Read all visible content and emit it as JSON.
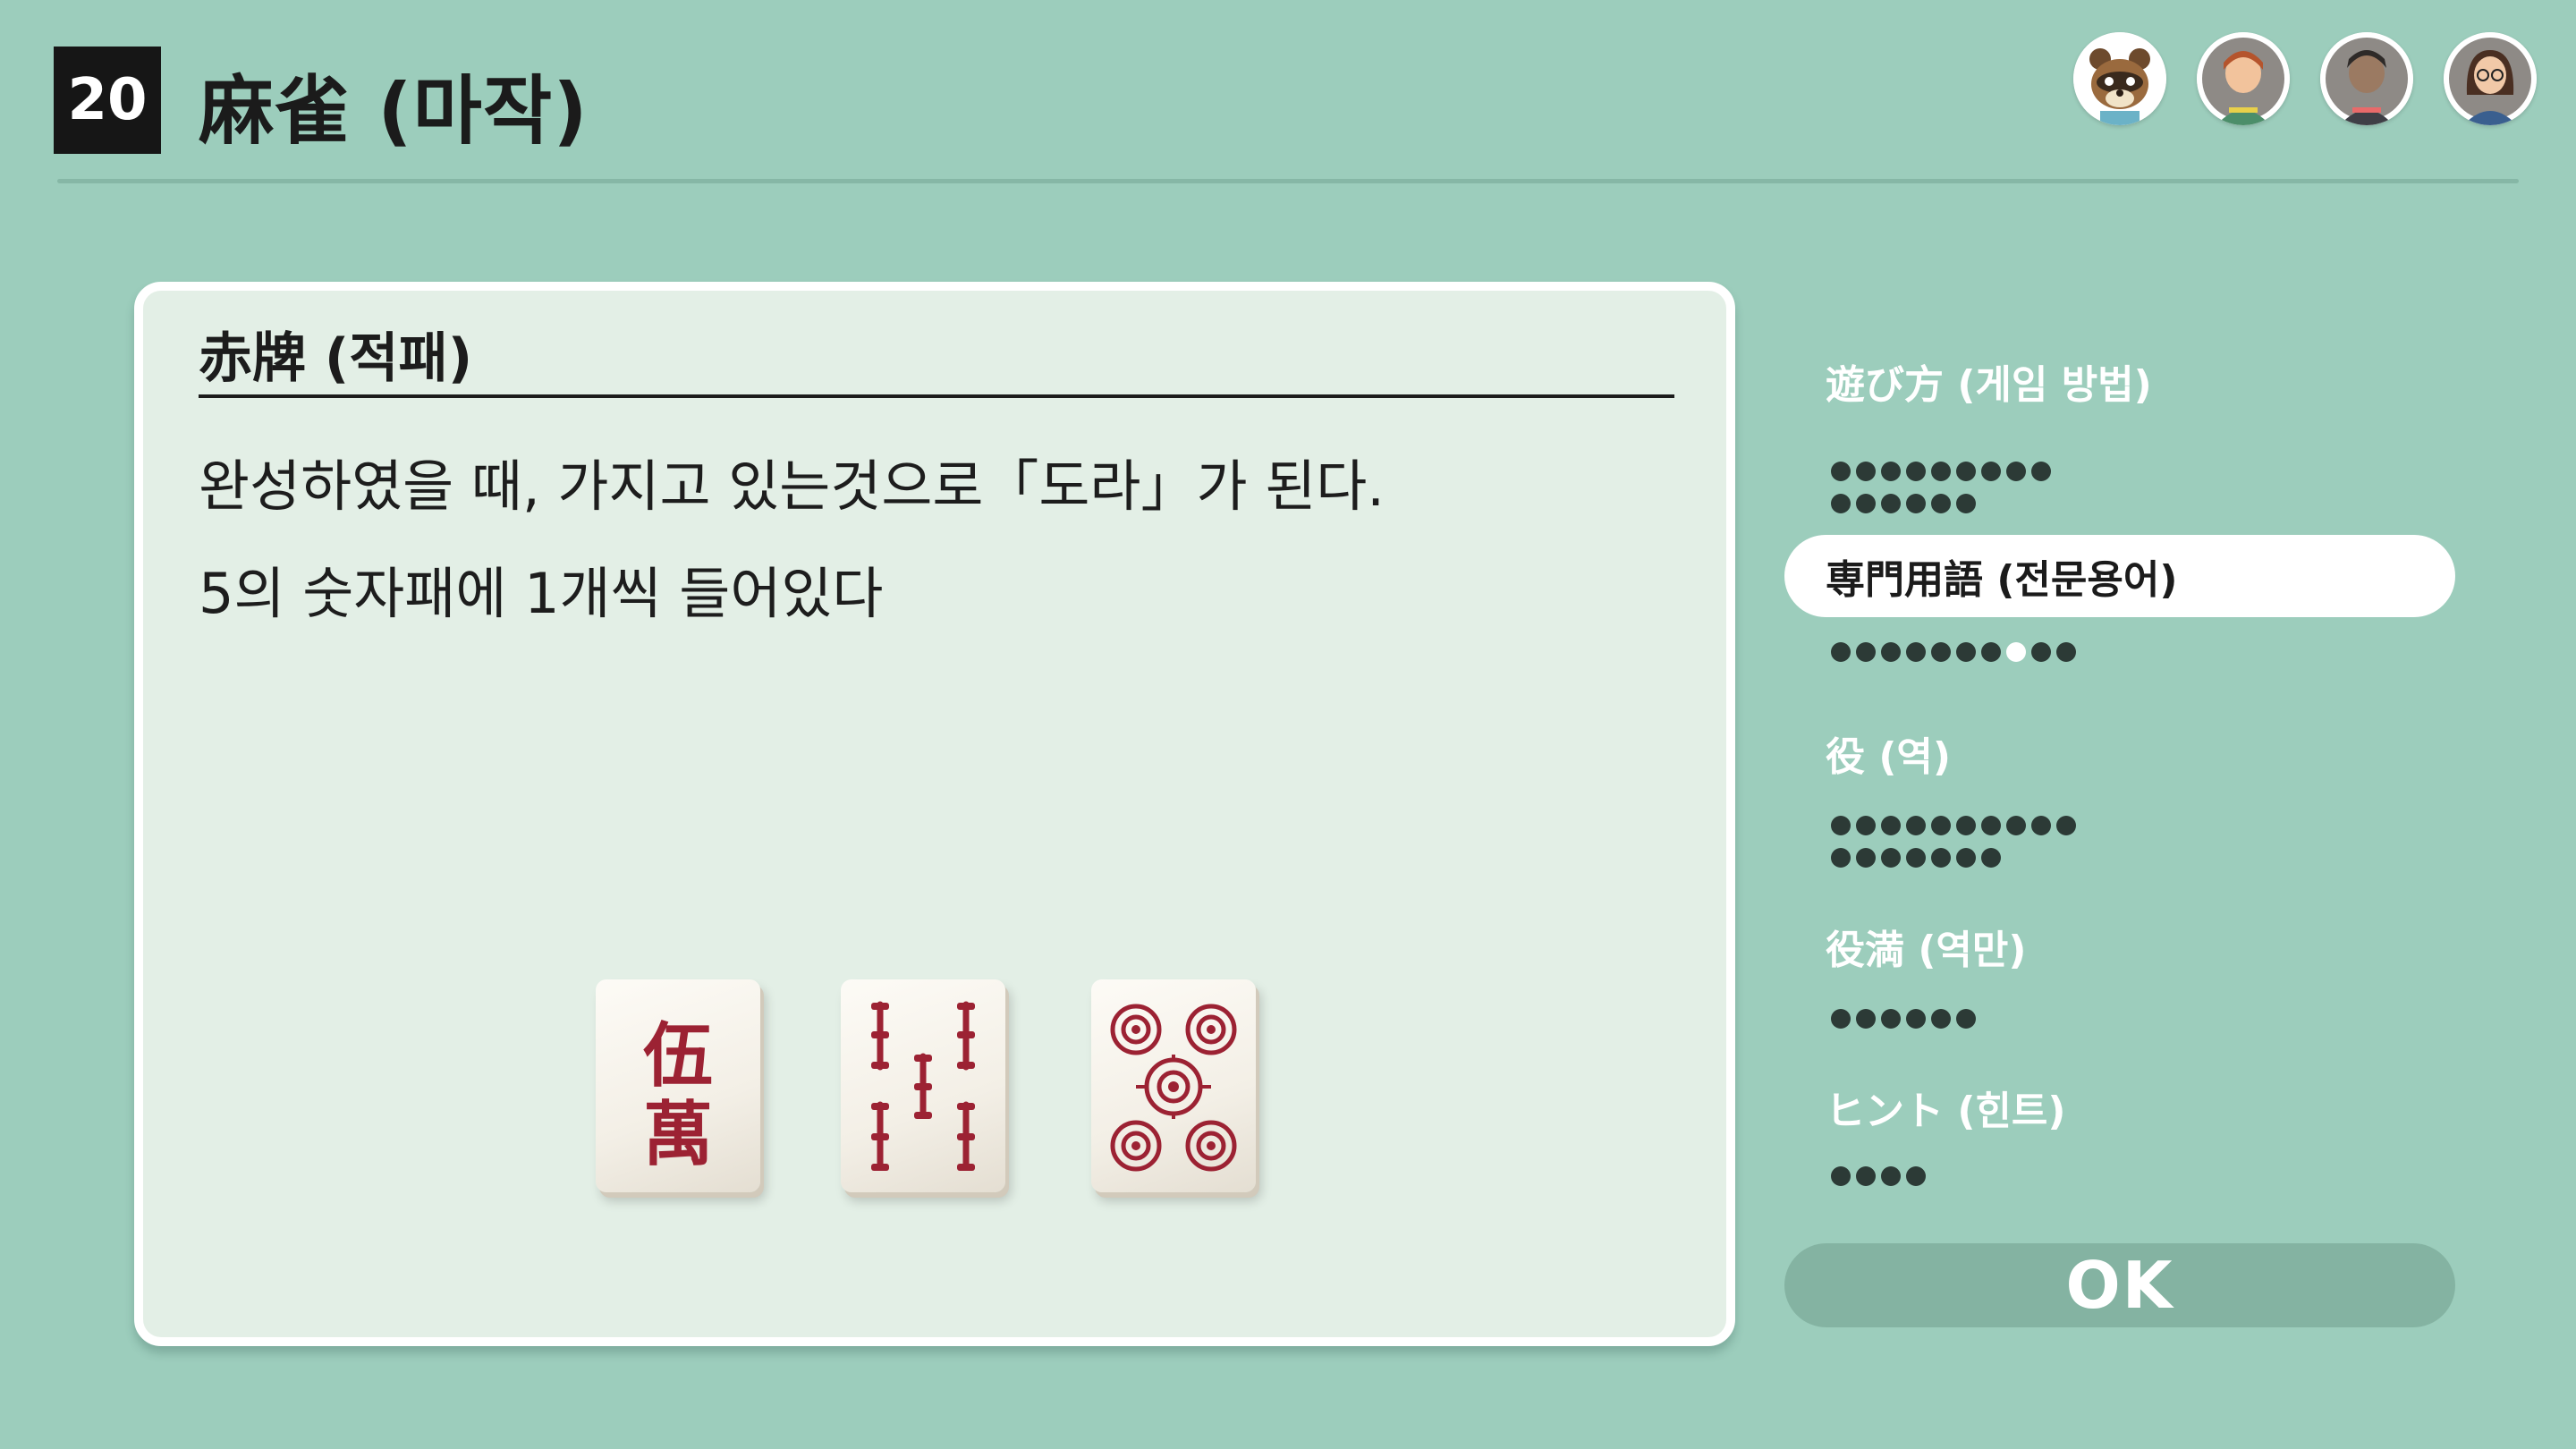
{
  "header": {
    "game_number": "20",
    "title": "麻雀 (마작)"
  },
  "players": [
    {
      "name": "tom-nook-avatar"
    },
    {
      "name": "player-avatar-red-hair"
    },
    {
      "name": "player-avatar-dark-hair"
    },
    {
      "name": "player-avatar-glasses"
    }
  ],
  "panel": {
    "heading": "赤牌 (적패)",
    "lines": [
      "완성하였을 때, 가지고 있는것으로「도라」가 된다.",
      "5의 숫자패에 1개씩 들어있다"
    ],
    "tiles": [
      {
        "name": "red-five-character-tile",
        "glyphs": [
          "伍",
          "萬"
        ]
      },
      {
        "name": "red-five-bamboo-tile"
      },
      {
        "name": "red-five-circle-tile"
      }
    ]
  },
  "sidebar": {
    "categories": [
      {
        "label": "遊び方 (게임 방법)",
        "dots": 15,
        "active_dot": -1,
        "selected": false
      },
      {
        "label": "専門用語 (전문용어)",
        "dots": 10,
        "active_dot": 7,
        "selected": true
      },
      {
        "label": "役 (역)",
        "dots": 17,
        "active_dot": -1,
        "selected": false
      },
      {
        "label": "役満 (역만)",
        "dots": 6,
        "active_dot": -1,
        "selected": false
      },
      {
        "label": "ヒント (힌트)",
        "dots": 4,
        "active_dot": -1,
        "selected": false
      }
    ]
  },
  "ok_button": {
    "label": "OK"
  },
  "colors": {
    "background": "#9ccdbc",
    "panel": "#e3efe6",
    "tile_red": "#9c2233",
    "dot": "#2c3a36",
    "ok_button": "#84b3a2"
  }
}
